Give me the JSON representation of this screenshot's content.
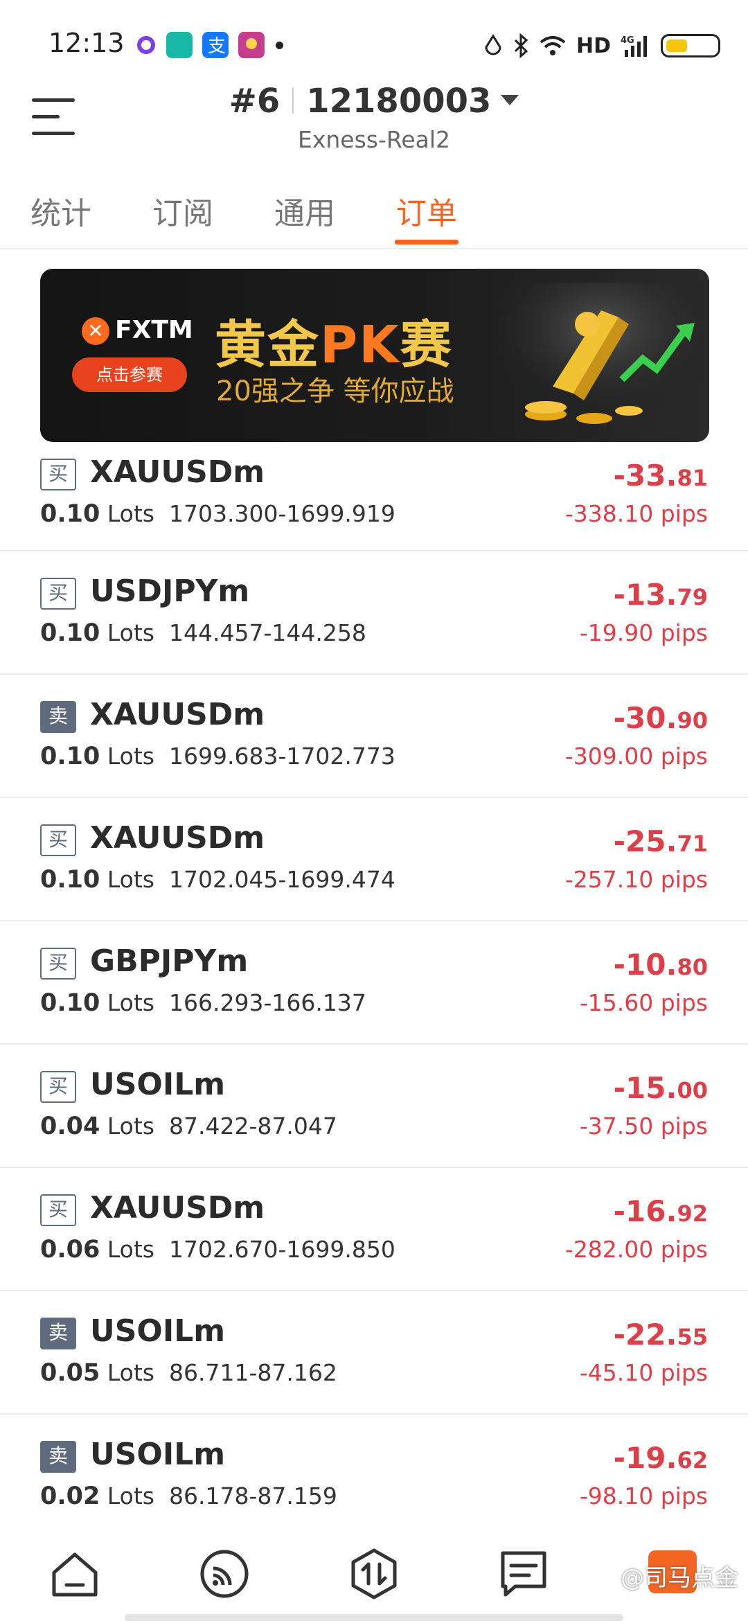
{
  "status_bar": {
    "time": "12:13",
    "hd_label": "HD",
    "network_label": "4G",
    "app_icons": [
      "app-icon-purple",
      "boss-icon",
      "alipay-icon",
      "weather-icon"
    ]
  },
  "header": {
    "account_index": "#6",
    "account_number": "12180003",
    "server": "Exness-Real2"
  },
  "tabs": [
    {
      "label": "统计",
      "active": false
    },
    {
      "label": "订阅",
      "active": false
    },
    {
      "label": "通用",
      "active": false
    },
    {
      "label": "订单",
      "active": true
    }
  ],
  "banner": {
    "brand": "FXTM",
    "button": "点击参赛",
    "title_a": "黄金",
    "title_pk": "PK",
    "title_b": "赛",
    "subtitle": "20强之争  等你应战"
  },
  "orders": [
    {
      "side": "买",
      "type": "buy",
      "symbol": "XAUUSDm",
      "lots": "0.10",
      "lots_unit": "Lots",
      "prices": "1703.300-1699.919",
      "profit_main": "-33.",
      "profit_cents": "81",
      "pips": "-338.10 pips"
    },
    {
      "side": "买",
      "type": "buy",
      "symbol": "USDJPYm",
      "lots": "0.10",
      "lots_unit": "Lots",
      "prices": "144.457-144.258",
      "profit_main": "-13.",
      "profit_cents": "79",
      "pips": "-19.90 pips"
    },
    {
      "side": "卖",
      "type": "sell",
      "symbol": "XAUUSDm",
      "lots": "0.10",
      "lots_unit": "Lots",
      "prices": "1699.683-1702.773",
      "profit_main": "-30.",
      "profit_cents": "90",
      "pips": "-309.00 pips"
    },
    {
      "side": "买",
      "type": "buy",
      "symbol": "XAUUSDm",
      "lots": "0.10",
      "lots_unit": "Lots",
      "prices": "1702.045-1699.474",
      "profit_main": "-25.",
      "profit_cents": "71",
      "pips": "-257.10 pips"
    },
    {
      "side": "买",
      "type": "buy",
      "symbol": "GBPJPYm",
      "lots": "0.10",
      "lots_unit": "Lots",
      "prices": "166.293-166.137",
      "profit_main": "-10.",
      "profit_cents": "80",
      "pips": "-15.60 pips"
    },
    {
      "side": "买",
      "type": "buy",
      "symbol": "USOILm",
      "lots": "0.04",
      "lots_unit": "Lots",
      "prices": "87.422-87.047",
      "profit_main": "-15.",
      "profit_cents": "00",
      "pips": "-37.50 pips"
    },
    {
      "side": "买",
      "type": "buy",
      "symbol": "XAUUSDm",
      "lots": "0.06",
      "lots_unit": "Lots",
      "prices": "1702.670-1699.850",
      "profit_main": "-16.",
      "profit_cents": "92",
      "pips": "-282.00 pips"
    },
    {
      "side": "卖",
      "type": "sell",
      "symbol": "USOILm",
      "lots": "0.05",
      "lots_unit": "Lots",
      "prices": "86.711-87.162",
      "profit_main": "-22.",
      "profit_cents": "55",
      "pips": "-45.10 pips"
    },
    {
      "side": "卖",
      "type": "sell",
      "symbol": "USOILm",
      "lots": "0.02",
      "lots_unit": "Lots",
      "prices": "86.178-87.159",
      "profit_main": "-19.",
      "profit_cents": "62",
      "pips": "-98.10 pips"
    }
  ],
  "bottom_nav": {
    "items": [
      "home-icon",
      "signal-icon",
      "trade-icon",
      "message-icon"
    ],
    "watermark": "@司马点金"
  },
  "colors": {
    "accent": "#f26522",
    "loss": "#d9404a",
    "side_badge": "#5f6b7d"
  }
}
